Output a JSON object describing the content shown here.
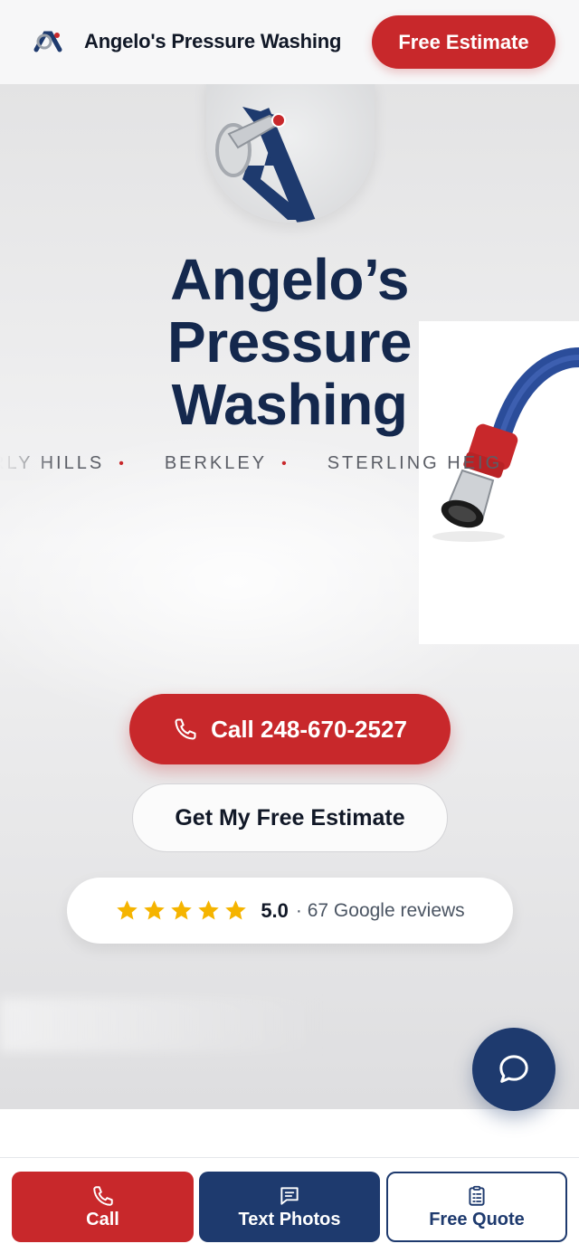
{
  "header": {
    "brand": "Angelo's Pressure Washing",
    "cta_label": "Free Estimate",
    "logo_icon": "angelo-logo-icon"
  },
  "hero": {
    "title_line1": "Angelo’s",
    "title_line2": "Pressure",
    "title_line3": "Washing",
    "cities": [
      "RLY HILLS",
      "BERKLEY",
      "STERLING HEIG"
    ],
    "call_label": "Call 248-670-2527",
    "estimate_label": "Get My Free Estimate",
    "rating": {
      "stars": 5,
      "score": "5.0",
      "count_label": "· 67 Google reviews"
    }
  },
  "bottom_bar": {
    "call_label": "Call",
    "text_label": "Text Photos",
    "quote_label": "Free Quote"
  },
  "colors": {
    "accent_red": "#c8282b",
    "navy": "#1e3a6e",
    "title": "#14284d",
    "star": "#f5b400"
  }
}
